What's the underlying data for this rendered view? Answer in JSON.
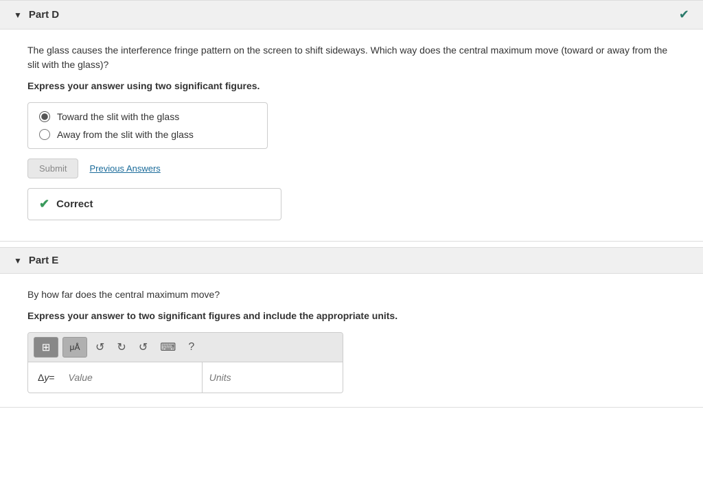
{
  "partD": {
    "title": "Part D",
    "checkmark": "✔",
    "question_text": "The glass causes the interference fringe pattern on the screen to shift sideways. Which way does the central maximum move (toward or away from the slit with the glass)?",
    "instruction": "Express your answer using two significant figures.",
    "options": [
      {
        "id": "opt1",
        "label": "Toward the slit with the glass",
        "selected": true
      },
      {
        "id": "opt2",
        "label": "Away from the slit with the glass",
        "selected": false
      }
    ],
    "submit_label": "Submit",
    "prev_answers_label": "Previous Answers",
    "correct_label": "Correct"
  },
  "partE": {
    "title": "Part E",
    "question_text": "By how far does the central maximum move?",
    "instruction": "Express your answer to two significant figures and include the appropriate units.",
    "toolbar": {
      "grid_label": "⊞",
      "mu_label": "μÅ",
      "undo_label": "↺",
      "redo_label": "↻",
      "refresh_label": "↻",
      "keyboard_label": "⌨",
      "help_label": "?"
    },
    "delta_label": "Δy =",
    "value_placeholder": "Value",
    "units_placeholder": "Units"
  },
  "colors": {
    "check_green": "#3a9a5c",
    "link_blue": "#1a6b9a",
    "header_check": "#2a7a6b"
  }
}
